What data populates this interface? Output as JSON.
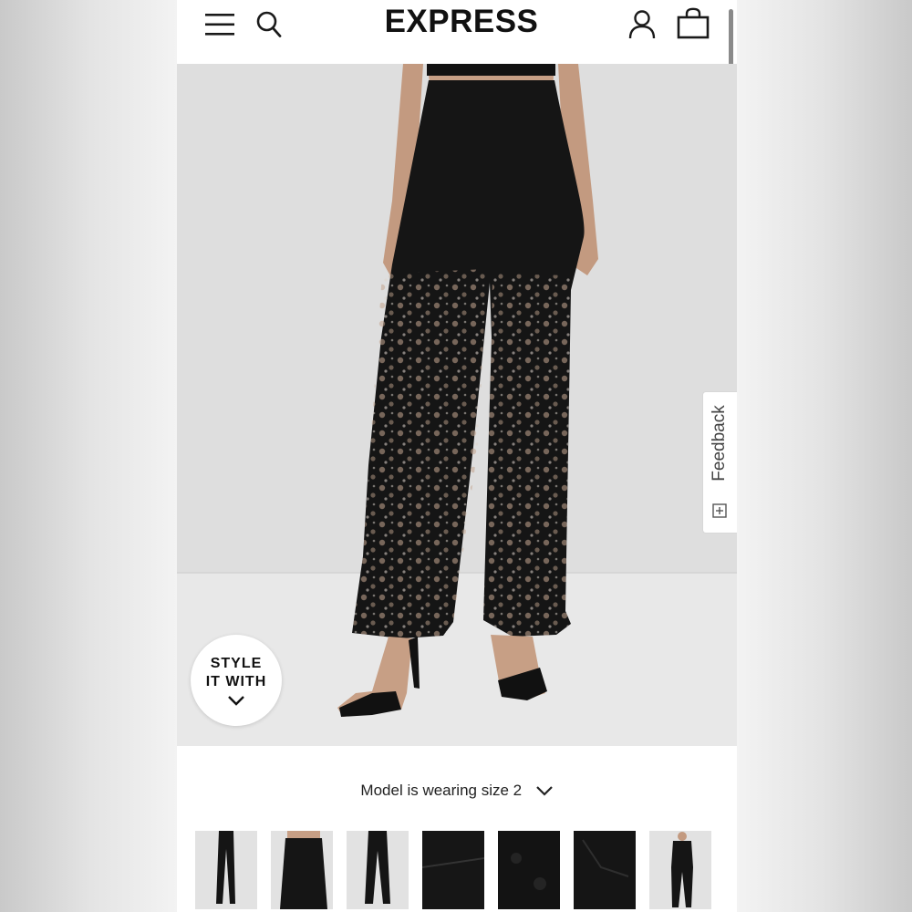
{
  "header": {
    "brand": "EXPRESS",
    "menu_icon": "hamburger-menu-icon",
    "search_icon": "search-icon",
    "account_icon": "user-account-icon",
    "bag_icon": "shopping-bag-icon"
  },
  "product_image": {
    "style_it_line1": "STYLE",
    "style_it_line2": "IT WITH",
    "style_it_icon": "chevron-down-icon"
  },
  "feedback": {
    "label": "Feedback",
    "icon": "feedback-plus-icon"
  },
  "size_info": {
    "text": "Model is wearing size 2",
    "icon": "chevron-down-icon"
  },
  "thumbnails": [
    {
      "view": "full-front"
    },
    {
      "view": "waist-side"
    },
    {
      "view": "full-back"
    },
    {
      "view": "fabric-detail"
    },
    {
      "view": "lace-detail"
    },
    {
      "view": "seam-detail"
    },
    {
      "view": "full-outfit"
    }
  ],
  "colors": {
    "accent": "#111111",
    "studio_wall": "#dedede",
    "floor": "#e9e9e9"
  }
}
